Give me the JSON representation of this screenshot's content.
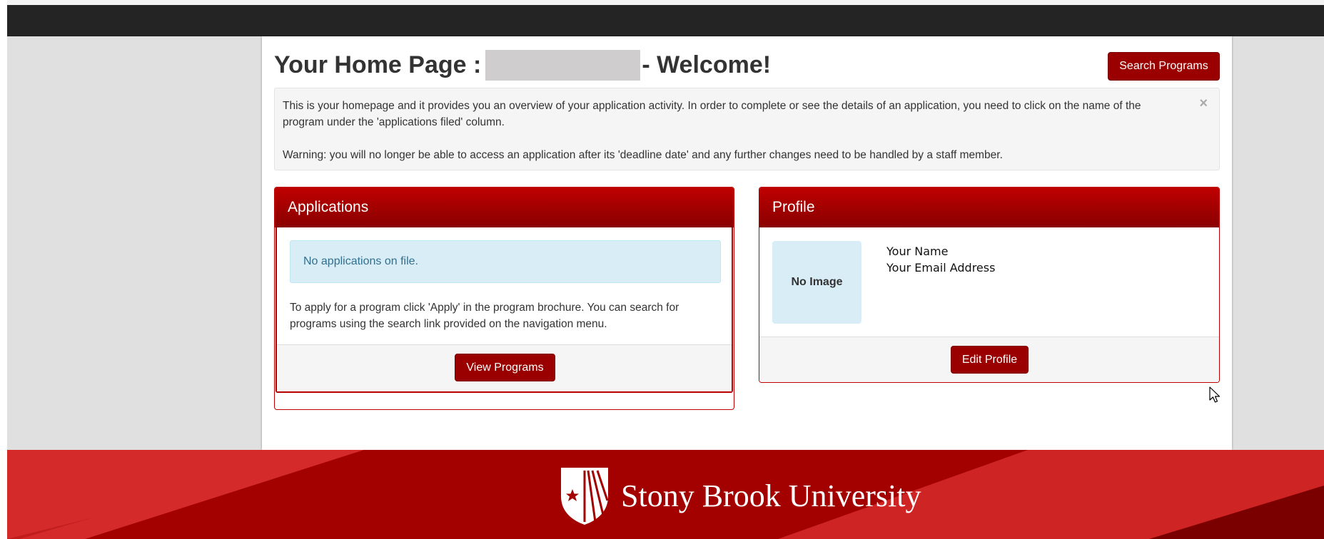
{
  "header": {
    "title_prefix": "Your Home Page :",
    "title_suffix": "- Welcome!",
    "search_button": "Search Programs"
  },
  "info": {
    "line1": "This is your homepage and it provides you an overview of your application activity. In order to complete or see the details of an application, you need to click on the name of the program under the 'applications filed' column.",
    "line2": "Warning: you will no longer be able to access an application after its 'deadline date' and any further changes need to be handled by a staff member.",
    "close_symbol": "×"
  },
  "applications": {
    "title": "Applications",
    "empty_message": "No applications on file.",
    "help_text": "To apply for a program click 'Apply' in the program brochure. You can search for programs using the search link provided on the navigation menu.",
    "view_button": "View Programs"
  },
  "profile": {
    "title": "Profile",
    "no_image": "No Image",
    "name": "Your Name",
    "email": "Your Email Address",
    "edit_button": "Edit Profile"
  },
  "footer": {
    "university_name": "Stony Brook University"
  },
  "colors": {
    "brand_red": "#9b0000",
    "topbar": "#242424",
    "info_blue": "#d9edf7"
  },
  "icons": {
    "cursor": "mouse-pointer-icon",
    "logo": "stony-brook-shield-logo"
  }
}
